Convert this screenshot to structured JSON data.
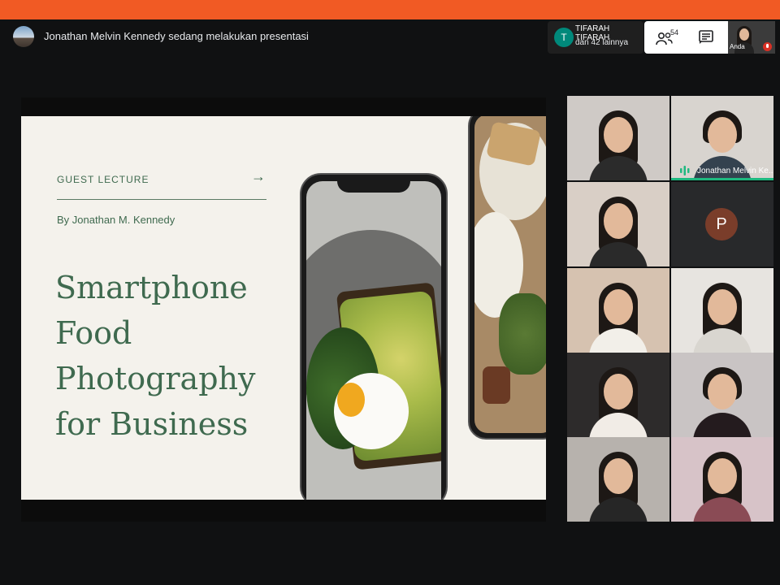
{
  "header": {
    "presenting_text": "Jonathan Melvin Kennedy sedang melakukan presentasi",
    "participant_chip": {
      "initial": "T",
      "name": "TIFARAH TIFARAH",
      "more": "dan 42 lainnya"
    },
    "people_count": "54",
    "self_label": "Anda"
  },
  "slide": {
    "kicker": "GUEST LECTURE",
    "arrow": "→",
    "byline": "By Jonathan M. Kennedy",
    "title_lines": [
      "Smartphone",
      "Food",
      "Photography",
      "for Business"
    ]
  },
  "participants": {
    "speaker_label": "Jonathan Melvin Ke...",
    "letter_avatar": "P"
  },
  "colors": {
    "accent_bar": "#f15a24",
    "slide_text": "#3f6a4f",
    "speaking": "#1eb980"
  }
}
